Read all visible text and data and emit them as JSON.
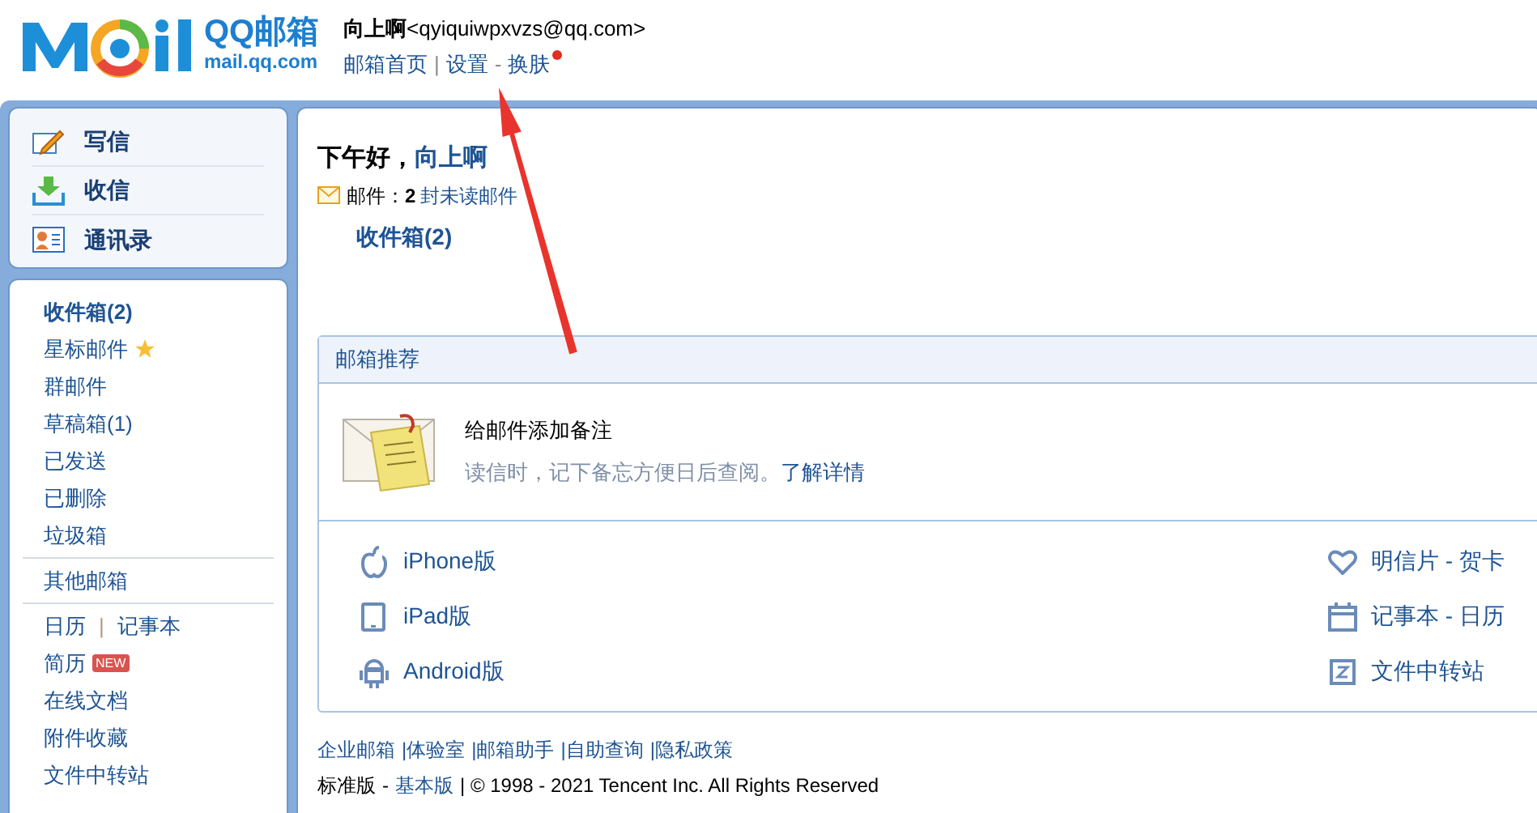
{
  "header": {
    "logo": {
      "brand": "QQ邮箱",
      "domain": "mail.qq.com"
    },
    "user": {
      "name": "向上啊",
      "email": "<qyiquiwpxvzs@qq.com>"
    },
    "nav": [
      {
        "kind": "link",
        "text": "邮箱首页",
        "dot": false
      },
      {
        "kind": "sep",
        "text": "|"
      },
      {
        "kind": "link",
        "text": "设置",
        "dot": false
      },
      {
        "kind": "sep",
        "text": "-"
      },
      {
        "kind": "link",
        "text": "换肤",
        "dot": true
      }
    ]
  },
  "sidebar": {
    "actions": [
      {
        "kind": "compose",
        "label": "写信"
      },
      {
        "kind": "receive",
        "label": "收信"
      },
      {
        "kind": "contacts",
        "label": "通讯录"
      }
    ],
    "groups": [
      [
        {
          "kind": "folder",
          "label": "收件箱(2)",
          "unread": true,
          "star": false
        },
        {
          "kind": "folder",
          "label": "星标邮件",
          "unread": false,
          "star": true
        },
        {
          "kind": "folder",
          "label": "群邮件",
          "unread": false,
          "star": false
        },
        {
          "kind": "folder",
          "label": "草稿箱(1)",
          "unread": false,
          "star": false
        },
        {
          "kind": "folder",
          "label": "已发送",
          "unread": false,
          "star": false
        },
        {
          "kind": "folder",
          "label": "已删除",
          "unread": false,
          "star": false
        },
        {
          "kind": "folder",
          "label": "垃圾箱",
          "unread": false,
          "star": false
        }
      ],
      [
        {
          "kind": "folder",
          "label": "其他邮箱",
          "unread": false,
          "star": false
        }
      ],
      [
        {
          "kind": "pair",
          "left": "日历",
          "sep": "|",
          "right": "记事本"
        },
        {
          "kind": "badge",
          "label": "简历",
          "badge": "NEW"
        },
        {
          "kind": "folder",
          "label": "在线文档",
          "unread": false,
          "star": false
        },
        {
          "kind": "folder",
          "label": "附件收藏",
          "unread": false,
          "star": false
        },
        {
          "kind": "folder",
          "label": "文件中转站",
          "unread": false,
          "star": false
        }
      ]
    ]
  },
  "main": {
    "greeting": {
      "prefix": "下午好，",
      "name": "向上啊"
    },
    "unread": {
      "label": "邮件：",
      "count": "2",
      "suffix": "封未读邮件"
    },
    "inbox_link": "收件箱(2)",
    "recommend": {
      "title": "邮箱推荐",
      "tip": {
        "title": "给邮件添加备注",
        "text": "读信时，记下备忘方便日后查阅。",
        "link": "了解详情"
      },
      "apps_left": [
        {
          "kind": "apple",
          "label": "iPhone版"
        },
        {
          "kind": "tablet",
          "label": "iPad版"
        },
        {
          "kind": "android",
          "label": "Android版"
        }
      ],
      "apps_right": [
        {
          "kind": "heart",
          "label": "明信片 - 贺卡"
        },
        {
          "kind": "calendar",
          "label": "记事本 - 日历"
        },
        {
          "kind": "transfer",
          "label": "文件中转站"
        }
      ]
    },
    "footer": {
      "links": [
        "企业邮箱",
        "|体验室",
        "|邮箱助手",
        "|自助查询",
        "|隐私政策"
      ],
      "version": [
        {
          "kind": "text",
          "text": "标准版"
        },
        {
          "kind": "text",
          "text": "-"
        },
        {
          "kind": "link",
          "text": "基本版"
        },
        {
          "kind": "text",
          "text": "| © 1998 - 2021 Tencent Inc. All Rights Reserved"
        }
      ]
    }
  }
}
